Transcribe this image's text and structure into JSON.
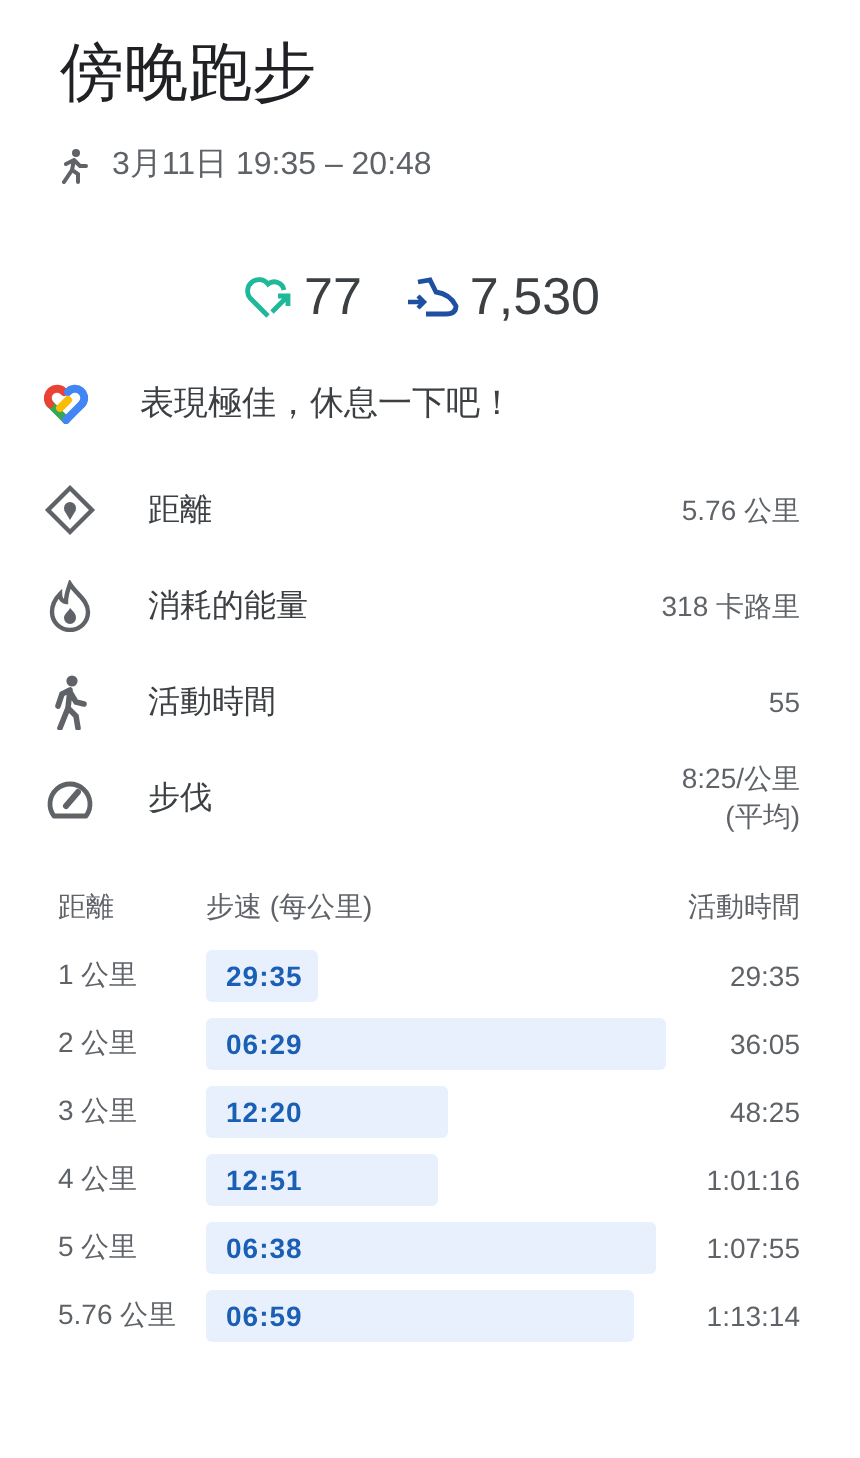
{
  "title": "傍晚跑步",
  "subtitle": "3月11日 19:35 – 20:48",
  "stats": [
    {
      "kind": "heart",
      "value": "77"
    },
    {
      "kind": "steps",
      "value": "7,530"
    }
  ],
  "message": "表現極佳，休息一下吧！",
  "metrics": [
    {
      "kind": "distance",
      "label": "距離",
      "value": "5.76 公里"
    },
    {
      "kind": "energy",
      "label": "消耗的能量",
      "value": "318 卡路里"
    },
    {
      "kind": "active",
      "label": "活動時間",
      "value": "55"
    },
    {
      "kind": "pace",
      "label": "步伐",
      "value": "8:25/公里",
      "note": "(平均)"
    }
  ],
  "splits": {
    "columns": [
      "距離",
      "步速 (每公里)",
      "活動時間"
    ],
    "rows": [
      {
        "distance": "1 公里",
        "pace": "29:35",
        "time": "29:35"
      },
      {
        "distance": "2 公里",
        "pace": "06:29",
        "time": "36:05"
      },
      {
        "distance": "3 公里",
        "pace": "12:20",
        "time": "48:25"
      },
      {
        "distance": "4 公里",
        "pace": "12:51",
        "time": "1:01:16"
      },
      {
        "distance": "5 公里",
        "pace": "06:38",
        "time": "1:07:55"
      },
      {
        "distance": "5.76 公里",
        "pace": "06:59",
        "time": "1:13:14"
      }
    ]
  }
}
